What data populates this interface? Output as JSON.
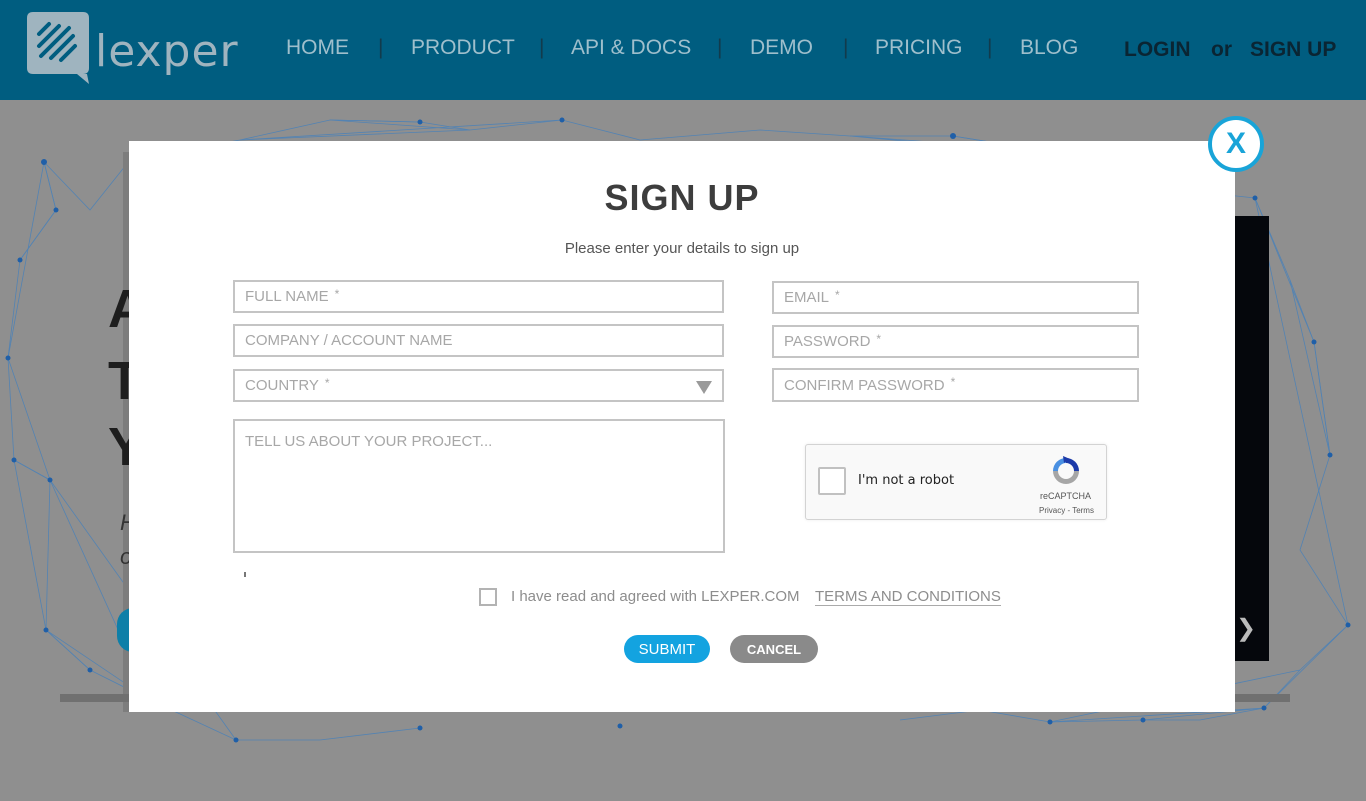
{
  "header": {
    "brand": "lexper",
    "nav": [
      "HOME",
      "PRODUCT",
      "API & DOCS",
      "DEMO",
      "PRICING",
      "BLOG"
    ],
    "separator": "|",
    "login": "LOGIN",
    "or": "or",
    "signup": "SIGN UP"
  },
  "background": {
    "glyphs": [
      "A",
      "T",
      "Y"
    ],
    "snippets": [
      "H",
      "o"
    ]
  },
  "modal": {
    "close_label": "X",
    "title": "SIGN UP",
    "subtitle": "Please enter your details to sign up",
    "fields": {
      "full_name": "FULL NAME",
      "company": "COMPANY / ACCOUNT NAME",
      "country": "COUNTRY",
      "project": "TELL US ABOUT YOUR PROJECT...",
      "email": "EMAIL",
      "password": "PASSWORD",
      "confirm_password": "CONFIRM PASSWORD"
    },
    "required_mark": "*",
    "captcha": {
      "label": "I'm not a robot",
      "brand": "reCAPTCHA",
      "links": "Privacy - Terms"
    },
    "agree_text": "I have read and agreed with LEXPER.COM",
    "terms_link": "TERMS AND CONDITIONS",
    "submit": "SUBMIT",
    "cancel": "CANCEL"
  },
  "colors": {
    "header_bg": "#005d80",
    "accent": "#13a3e0",
    "close_ring": "#19a4d8",
    "cancel_bg": "#8a8a8a"
  }
}
